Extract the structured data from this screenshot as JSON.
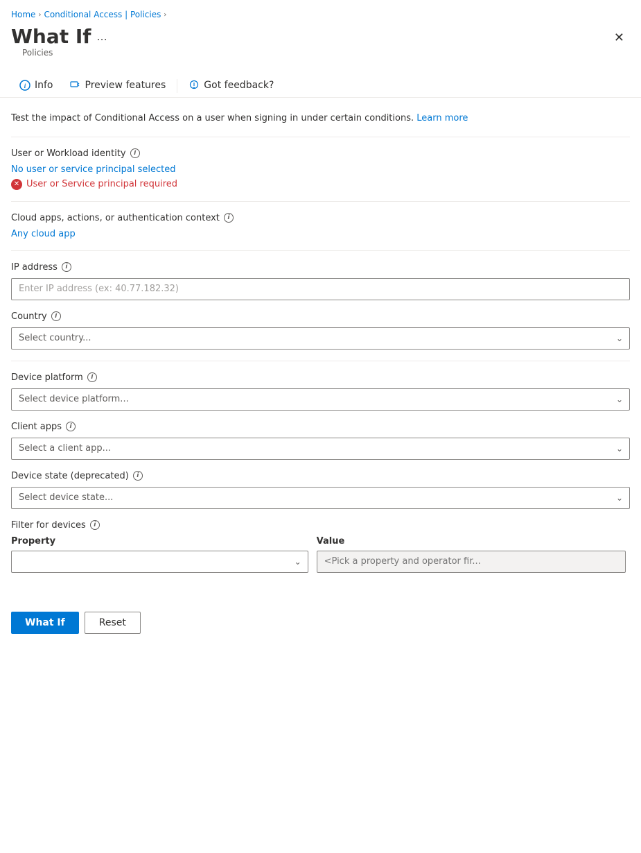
{
  "breadcrumb": {
    "home": "Home",
    "conditional_access": "Conditional Access | Policies",
    "separator": "›"
  },
  "header": {
    "title": "What If",
    "more_options": "...",
    "subtitle": "Policies"
  },
  "toolbar": {
    "info_label": "Info",
    "preview_features_label": "Preview features",
    "feedback_label": "Got feedback?"
  },
  "description": {
    "text": "Test the impact of Conditional Access on a user when signing in under certain conditions.",
    "learn_more_label": "Learn more"
  },
  "user_identity": {
    "label": "User or Workload identity",
    "link_text": "No user or service principal selected",
    "error_text": "User or Service principal required"
  },
  "cloud_apps": {
    "label": "Cloud apps, actions, or authentication context",
    "link_text": "Any cloud app"
  },
  "ip_address": {
    "label": "IP address",
    "placeholder": "Enter IP address (ex: 40.77.182.32)"
  },
  "country": {
    "label": "Country",
    "placeholder": "Select country...",
    "options": [
      "Select country..."
    ]
  },
  "device_platform": {
    "label": "Device platform",
    "placeholder": "Select device platform...",
    "options": [
      "Select device platform..."
    ]
  },
  "client_apps": {
    "label": "Client apps",
    "placeholder": "Select a client app...",
    "options": [
      "Select a client app..."
    ]
  },
  "device_state": {
    "label": "Device state (deprecated)",
    "placeholder": "Select device state...",
    "options": [
      "Select device state..."
    ]
  },
  "filter_devices": {
    "label": "Filter for devices",
    "property_header": "Property",
    "value_header": "Value",
    "property_placeholder": "",
    "value_placeholder": "<Pick a property and operator fir..."
  },
  "buttons": {
    "what_if": "What If",
    "reset": "Reset"
  }
}
